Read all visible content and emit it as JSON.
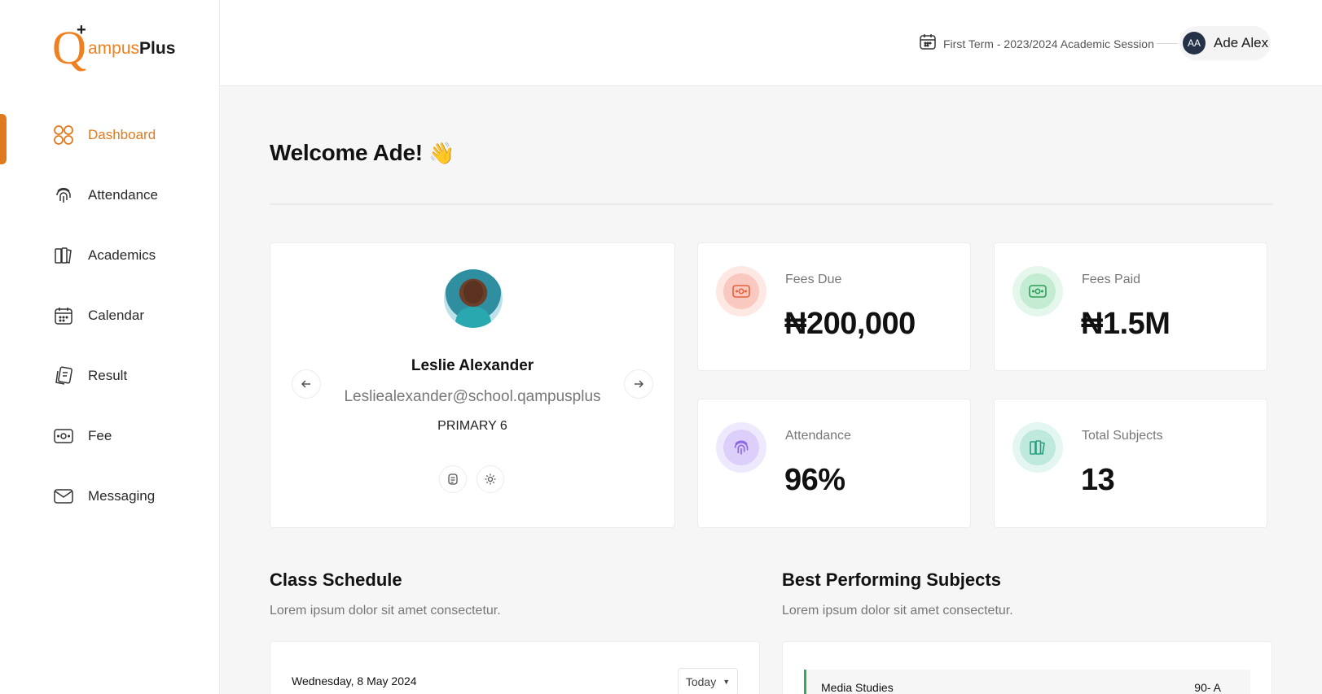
{
  "brand": {
    "logo_q": "Q",
    "logo_plus": "+",
    "logo_name_part1": "ampus",
    "logo_name_part2": "Plus"
  },
  "sidebar": {
    "items": [
      {
        "label": "Dashboard",
        "icon": "grid-icon",
        "active": true
      },
      {
        "label": "Attendance",
        "icon": "fingerprint-icon"
      },
      {
        "label": "Academics",
        "icon": "books-icon"
      },
      {
        "label": "Calendar",
        "icon": "calendar-icon"
      },
      {
        "label": "Result",
        "icon": "result-icon"
      },
      {
        "label": "Fee",
        "icon": "money-icon"
      },
      {
        "label": "Messaging",
        "icon": "mail-icon"
      }
    ]
  },
  "header": {
    "session": "First Term - 2023/2024 Academic Session",
    "user_initials": "AA",
    "user_name": "Ade Alex"
  },
  "welcome": {
    "text": "Welcome Ade!",
    "emoji": "👋"
  },
  "profile": {
    "name": "Leslie Alexander",
    "email": "Lesliealexander@school.qampusplus",
    "class": "PRIMARY 6"
  },
  "stats": [
    {
      "label": "Fees Due",
      "value": "₦200,000",
      "icon": "money-icon",
      "ring": "#fde8e4",
      "inner": "#f9c9bf",
      "stroke": "#e8603c"
    },
    {
      "label": "Fees Paid",
      "value": "₦1.5M",
      "icon": "money-icon",
      "ring": "#e5f7ec",
      "inner": "#c4ecd3",
      "stroke": "#2f9e5a"
    },
    {
      "label": "Attendance",
      "value": "96%",
      "icon": "fingerprint-icon",
      "ring": "#efe9fd",
      "inner": "#dcd0fb",
      "stroke": "#8a63e6"
    },
    {
      "label": "Total Subjects",
      "value": "13",
      "icon": "books-icon",
      "ring": "#e3f6f1",
      "inner": "#bfe9dd",
      "stroke": "#2a9e80"
    }
  ],
  "schedule": {
    "title": "Class Schedule",
    "subtitle": "Lorem ipsum dolor sit amet consectetur.",
    "date": "Wednesday, 8 May 2024",
    "filter": "Today"
  },
  "best_subjects": {
    "title": "Best Performing Subjects",
    "subtitle": "Lorem ipsum dolor sit amet consectetur.",
    "items": [
      {
        "name": "Media Studies",
        "score": "90- A"
      }
    ]
  },
  "colors": {
    "accent": "#e07a1f",
    "success": "#3aa65a"
  }
}
